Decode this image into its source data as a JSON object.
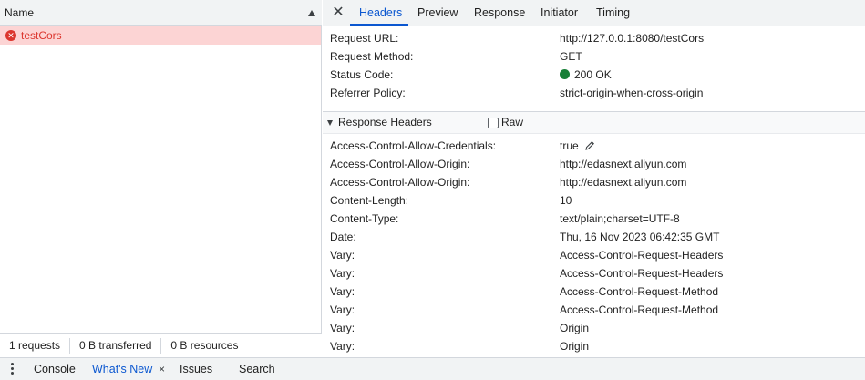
{
  "left": {
    "column_header": "Name",
    "request": {
      "name": "testCors",
      "status": "error"
    },
    "status_bar": {
      "requests": "1 requests",
      "transferred": "0 B transferred",
      "resources": "0 B resources"
    }
  },
  "tabs": {
    "close_glyph": "✕",
    "items": [
      "Headers",
      "Preview",
      "Response",
      "Initiator",
      "Timing"
    ],
    "active": "Headers"
  },
  "general": [
    {
      "key": "Request URL:",
      "value": "http://127.0.0.1:8080/testCors"
    },
    {
      "key": "Request Method:",
      "value": "GET"
    },
    {
      "key": "Status Code:",
      "value": "200 OK"
    },
    {
      "key": "Referrer Policy:",
      "value": "strict-origin-when-cross-origin"
    }
  ],
  "response_headers": {
    "title": "Response Headers",
    "raw_label": "Raw",
    "rows": [
      {
        "key": "Access-Control-Allow-Credentials:",
        "value": "true"
      },
      {
        "key": "Access-Control-Allow-Origin:",
        "value": "http://edasnext.aliyun.com"
      },
      {
        "key": "Access-Control-Allow-Origin:",
        "value": "http://edasnext.aliyun.com"
      },
      {
        "key": "Content-Length:",
        "value": "10"
      },
      {
        "key": "Content-Type:",
        "value": "text/plain;charset=UTF-8"
      },
      {
        "key": "Date:",
        "value": "Thu, 16 Nov 2023 06:42:35 GMT"
      },
      {
        "key": "Vary:",
        "value": "Access-Control-Request-Headers"
      },
      {
        "key": "Vary:",
        "value": "Access-Control-Request-Headers"
      },
      {
        "key": "Vary:",
        "value": "Access-Control-Request-Method"
      },
      {
        "key": "Vary:",
        "value": "Access-Control-Request-Method"
      },
      {
        "key": "Vary:",
        "value": "Origin"
      },
      {
        "key": "Vary:",
        "value": "Origin"
      }
    ]
  },
  "drawer": {
    "tabs": [
      "Console",
      "What's New",
      "Issues",
      "Search"
    ],
    "active": "What's New",
    "close_glyph": "×"
  },
  "colors": {
    "accent": "#0b57d0",
    "error": "#dc362e",
    "error_row_bg": "#fcd4d4",
    "status_ok": "#188038"
  }
}
